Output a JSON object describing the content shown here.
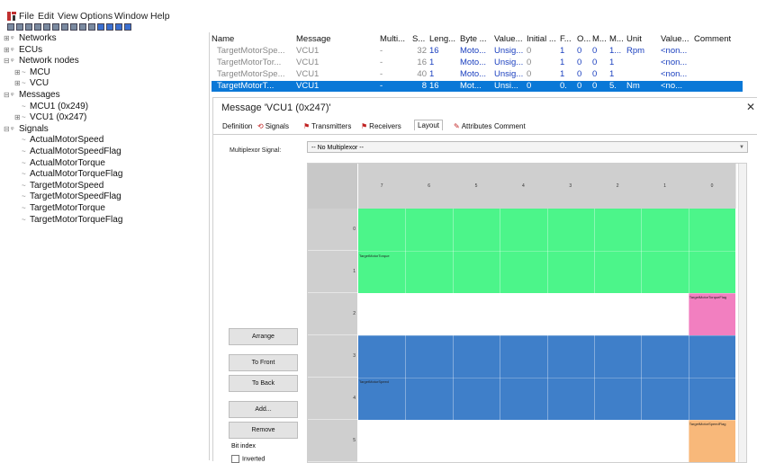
{
  "menu": [
    "File",
    "Edit",
    "View",
    "Options",
    "Window",
    "Help"
  ],
  "tree": [
    {
      "label": "Networks",
      "level": 0,
      "exp": "⊞"
    },
    {
      "label": "ECUs",
      "level": 0,
      "exp": "⊞"
    },
    {
      "label": "Network nodes",
      "level": 0,
      "exp": "⊟"
    },
    {
      "label": "MCU",
      "level": 1,
      "exp": "⊞"
    },
    {
      "label": "VCU",
      "level": 1,
      "exp": "⊞"
    },
    {
      "label": "Messages",
      "level": 0,
      "exp": "⊟"
    },
    {
      "label": "MCU1 (0x249)",
      "level": 1,
      "exp": ""
    },
    {
      "label": "VCU1 (0x247)",
      "level": 1,
      "exp": "⊞"
    },
    {
      "label": "Signals",
      "level": 0,
      "exp": "⊟"
    },
    {
      "label": "ActualMotorSpeed",
      "level": 1,
      "exp": ""
    },
    {
      "label": "ActualMotorSpeedFlag",
      "level": 1,
      "exp": ""
    },
    {
      "label": "ActualMotorTorque",
      "level": 1,
      "exp": ""
    },
    {
      "label": "ActualMotorTorqueFlag",
      "level": 1,
      "exp": ""
    },
    {
      "label": "TargetMotorSpeed",
      "level": 1,
      "exp": ""
    },
    {
      "label": "TargetMotorSpeedFlag",
      "level": 1,
      "exp": ""
    },
    {
      "label": "TargetMotorTorque",
      "level": 1,
      "exp": ""
    },
    {
      "label": "TargetMotorTorqueFlag",
      "level": 1,
      "exp": ""
    }
  ],
  "signal_table": {
    "headers": [
      "Name",
      "Message",
      "Multi...",
      "S...",
      "Leng...",
      "Byte ...",
      "Value...",
      "Initial ...",
      "F...",
      "O...",
      "M...",
      "M...",
      "Unit",
      "Value...",
      "Comment"
    ],
    "rows": [
      {
        "cells": [
          "TargetMotorSpe...",
          "VCU1",
          "-",
          "32",
          "16",
          "Moto...",
          "Unsig...",
          "0",
          "1",
          "0",
          "0",
          "1...",
          "Rpm",
          "<non...",
          ""
        ],
        "selected": false
      },
      {
        "cells": [
          "TargetMotorTor...",
          "VCU1",
          "-",
          "16",
          "1",
          "Moto...",
          "Unsig...",
          "0",
          "1",
          "0",
          "0",
          "1",
          "",
          "<non...",
          ""
        ],
        "selected": false
      },
      {
        "cells": [
          "TargetMotorSpe...",
          "VCU1",
          "-",
          "40",
          "1",
          "Moto...",
          "Unsig...",
          "0",
          "1",
          "0",
          "0",
          "1",
          "",
          "<non...",
          ""
        ],
        "selected": false
      },
      {
        "cells": [
          "TargetMotorT...",
          "VCU1",
          "-",
          "8",
          "16",
          "Mot...",
          "Unsi...",
          "0",
          "0.",
          "0",
          "0",
          "5.",
          "Nm",
          "<no...",
          ""
        ],
        "selected": true
      }
    ]
  },
  "dialog": {
    "title": "Message 'VCU1 (0x247)'",
    "close": "✕",
    "tabs": [
      {
        "label": "Definition",
        "icon": ""
      },
      {
        "label": "Signals",
        "icon": "⟲"
      },
      {
        "label": "Transmitters",
        "icon": "⚑"
      },
      {
        "label": "Receivers",
        "icon": "⚑"
      },
      {
        "label": "Layout",
        "icon": "",
        "active": true
      },
      {
        "label": "Attributes",
        "icon": "✎"
      },
      {
        "label": "Comment",
        "icon": ""
      }
    ],
    "multiplexor_label": "Multiplexor Signal:",
    "multiplexor_value": "-- No Multiplexor --",
    "buttons": {
      "arrange": "Arrange",
      "to_front": "To Front",
      "to_back": "To Back",
      "add": "Add...",
      "remove": "Remove"
    },
    "bit_index": "Bit index",
    "inverted": "Inverted"
  },
  "layout_grid": {
    "col_headers": [
      "7",
      "6",
      "5",
      "4",
      "3",
      "2",
      "1",
      "0"
    ],
    "row_headers": [
      "0",
      "1",
      "2",
      "3",
      "4",
      "5"
    ],
    "signal_labels": {
      "target_motor_torque": "TargetMotorTorque",
      "target_motor_torque_flag": "TargetMotorTorqueFlag",
      "target_motor_speed": "TargetMotorSpeed",
      "target_motor_speed_flag": "TargetMotorSpeedFlag"
    },
    "colors": {
      "green": "#4cf58a",
      "blue": "#3f7fc9",
      "pink": "#f27fc0",
      "orange": "#f8b87a",
      "header": "#cfcfcf"
    }
  },
  "colors": {
    "selection": "#0a78d7",
    "link_blue": "#1a3fbf"
  }
}
